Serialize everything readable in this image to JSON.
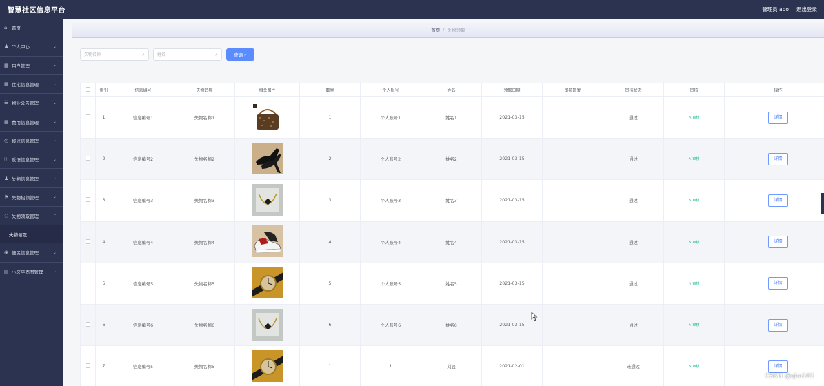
{
  "app": {
    "title": "智慧社区信息平台"
  },
  "topbar": {
    "user_label": "管理员 abo",
    "logout_label": "退出登录"
  },
  "sidebar": {
    "items": [
      {
        "label": "首页",
        "icon": "home-icon",
        "glyph": "⌂",
        "arrow": ""
      },
      {
        "label": "个人中心",
        "icon": "user-icon",
        "glyph": "♟",
        "arrow": "⌄"
      },
      {
        "label": "用户管理",
        "icon": "grid-icon",
        "glyph": "▦",
        "arrow": "⌄"
      },
      {
        "label": "住宅信息管理",
        "icon": "grid-icon",
        "glyph": "▦",
        "arrow": "⌄"
      },
      {
        "label": "物业公告管理",
        "icon": "sliders-icon",
        "glyph": "☰",
        "arrow": "⌄"
      },
      {
        "label": "费用信息管理",
        "icon": "grid-icon",
        "glyph": "▦",
        "arrow": "⌄"
      },
      {
        "label": "报修信息管理",
        "icon": "clock-icon",
        "glyph": "◷",
        "arrow": "⌄"
      },
      {
        "label": "反馈信息管理",
        "icon": "apps-icon",
        "glyph": "∷",
        "arrow": "⌄"
      },
      {
        "label": "失物信息管理",
        "icon": "user-icon",
        "glyph": "♟",
        "arrow": "⌄"
      },
      {
        "label": "失物招领管理",
        "icon": "flag-icon",
        "glyph": "⚑",
        "arrow": "⌄"
      },
      {
        "label": "失物领取管理",
        "icon": "circle-icon",
        "glyph": "◌",
        "arrow": "⌃"
      }
    ],
    "sub_item": "失物领取",
    "items_after": [
      {
        "label": "便民信息管理",
        "icon": "info-icon",
        "glyph": "◉",
        "arrow": "⌄"
      },
      {
        "label": "小区平面图管理",
        "icon": "document-icon",
        "glyph": "▤",
        "arrow": "⌄"
      }
    ]
  },
  "breadcrumb": {
    "home": "首页",
    "separator": "/",
    "current": "失物领取"
  },
  "search": {
    "name_placeholder": "失物名称",
    "person_placeholder": "姓名",
    "query_label": "查询"
  },
  "table": {
    "headers": [
      "索引",
      "信息编号",
      "失物名称",
      "相关图片",
      "数量",
      "个人账号",
      "姓名",
      "领取日期",
      "审核回复",
      "审核状态",
      "审核",
      "操作"
    ],
    "audit_label": "审核",
    "detail_label": "详情",
    "rows": [
      {
        "index": "1",
        "code": "信息编号1",
        "name": "失物名称1",
        "image": "handbag",
        "qty": "1",
        "account": "个人账号1",
        "person": "姓名1",
        "date": "2021-03-15",
        "reply": "",
        "status": "通过"
      },
      {
        "index": "2",
        "code": "信息编号2",
        "name": "失物名称2",
        "image": "heels",
        "qty": "2",
        "account": "个人账号2",
        "person": "姓名2",
        "date": "2021-03-15",
        "reply": "",
        "status": "通过"
      },
      {
        "index": "3",
        "code": "信息编号3",
        "name": "失物名称3",
        "image": "necklace",
        "qty": "3",
        "account": "个人账号3",
        "person": "姓名3",
        "date": "2021-03-15",
        "reply": "",
        "status": "通过"
      },
      {
        "index": "4",
        "code": "信息编号4",
        "name": "失物名称4",
        "image": "sneakers",
        "qty": "4",
        "account": "个人账号4",
        "person": "姓名4",
        "date": "2021-03-15",
        "reply": "",
        "status": "通过"
      },
      {
        "index": "5",
        "code": "信息编号5",
        "name": "失物名称5",
        "image": "watch",
        "qty": "5",
        "account": "个人账号5",
        "person": "姓名5",
        "date": "2021-03-15",
        "reply": "",
        "status": "通过"
      },
      {
        "index": "6",
        "code": "信息编号6",
        "name": "失物名称6",
        "image": "necklace",
        "qty": "6",
        "account": "个人账号6",
        "person": "姓名6",
        "date": "2021-03-15",
        "reply": "",
        "status": "通过"
      },
      {
        "index": "7",
        "code": "信息编号5",
        "name": "失物名称5",
        "image": "watch",
        "qty": "1",
        "account": "1",
        "person": "刘晨",
        "date": "2021-02-01",
        "reply": "",
        "status": "未通过"
      }
    ]
  },
  "watermark": "CSDN @qha101"
}
